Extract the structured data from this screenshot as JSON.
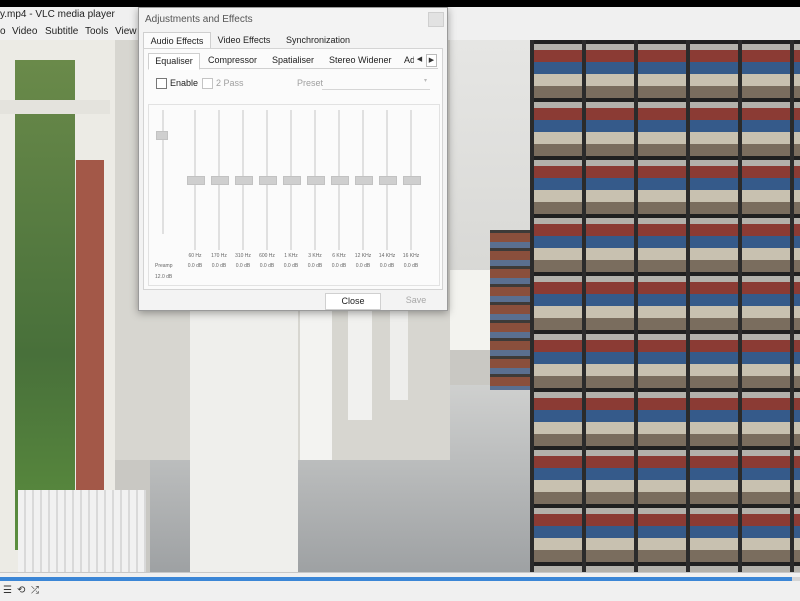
{
  "window": {
    "title": "y.mp4 - VLC media player",
    "menu": [
      "o",
      "Video",
      "Subtitle",
      "Tools",
      "View"
    ]
  },
  "dialog": {
    "title": "Adjustments and Effects",
    "tabs": [
      "Audio Effects",
      "Video Effects",
      "Synchronization"
    ],
    "subtabs": [
      "Equaliser",
      "Compressor",
      "Spatialiser",
      "Stereo Widener",
      "Ad"
    ],
    "enable_label": "Enable",
    "enable_checked": false,
    "two_pass_label": "2 Pass",
    "two_pass_checked": false,
    "preset_label": "Preset",
    "preamp": {
      "label": "Preamp",
      "value": "12.0 dB"
    },
    "bands": [
      {
        "freq": "60 Hz",
        "gain": "0.0 dB"
      },
      {
        "freq": "170 Hz",
        "gain": "0.0 dB"
      },
      {
        "freq": "310 Hz",
        "gain": "0.0 dB"
      },
      {
        "freq": "600 Hz",
        "gain": "0.0 dB"
      },
      {
        "freq": "1 KHz",
        "gain": "0.0 dB"
      },
      {
        "freq": "3 KHz",
        "gain": "0.0 dB"
      },
      {
        "freq": "6 KHz",
        "gain": "0.0 dB"
      },
      {
        "freq": "12 KHz",
        "gain": "0.0 dB"
      },
      {
        "freq": "14 KHz",
        "gain": "0.0 dB"
      },
      {
        "freq": "16 KHz",
        "gain": "0.0 dB"
      }
    ],
    "close_label": "Close",
    "save_label": "Save"
  },
  "playback": {
    "progress": 0.99
  },
  "controls": {
    "icons": [
      "playlist-icon",
      "loop-icon",
      "shuffle-icon"
    ]
  },
  "colors": {
    "accent": "#3b86d6"
  }
}
